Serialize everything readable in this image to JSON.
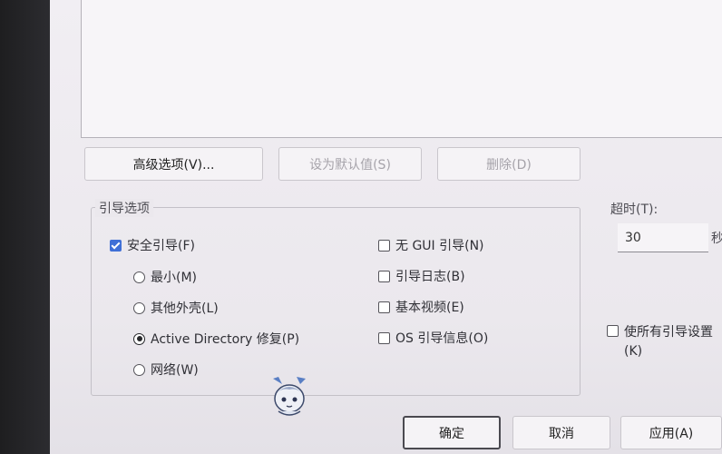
{
  "buttons": {
    "advanced": "高级选项(V)...",
    "set_default": "设为默认值(S)",
    "delete": "删除(D)"
  },
  "boot_options": {
    "title": "引导选项",
    "safe_boot": "安全引导(F)",
    "minimal": "最小(M)",
    "alternate_shell": "其他外壳(L)",
    "ad_repair": "Active Directory 修复(P)",
    "network": "网络(W)",
    "no_gui": "无 GUI 引导(N)",
    "boot_log": "引导日志(B)",
    "base_video": "基本视频(E)",
    "os_boot_info": "OS 引导信息(O)"
  },
  "timeout": {
    "label": "超时(T):",
    "value": "30",
    "unit": "秒"
  },
  "make_permanent": {
    "line1": "使所有引导设置",
    "line2": "(K)"
  },
  "footer": {
    "ok": "确定",
    "cancel": "取消",
    "apply": "应用(A)"
  },
  "state": {
    "safe_boot_checked": true,
    "selected_safe_mode": "Active Directory 修复(P)"
  }
}
